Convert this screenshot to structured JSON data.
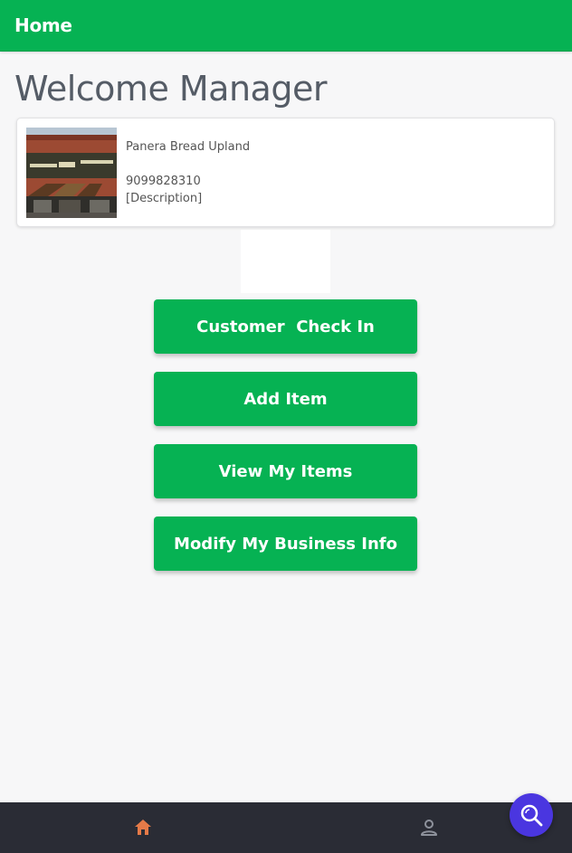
{
  "header": {
    "title": "Home"
  },
  "page": {
    "welcome": "Welcome Manager"
  },
  "business": {
    "name": "Panera Bread Upland",
    "phone": "9099828310",
    "description": "[Description]"
  },
  "actions": {
    "checkin": "Customer  Check In",
    "add_item": "Add Item",
    "view_items": "View My Items",
    "modify_info": "Modify My Business Info"
  },
  "tabs": [
    {
      "icon": "home-icon",
      "active": true
    },
    {
      "icon": "person-icon",
      "active": false
    }
  ],
  "fab": {
    "icon": "search-icon"
  },
  "colors": {
    "primary": "#06b253",
    "tab_active": "#e57a48",
    "tab_inactive": "#8e929c",
    "bottom_bar": "#2a2c35",
    "fab": "#4a36e0"
  }
}
